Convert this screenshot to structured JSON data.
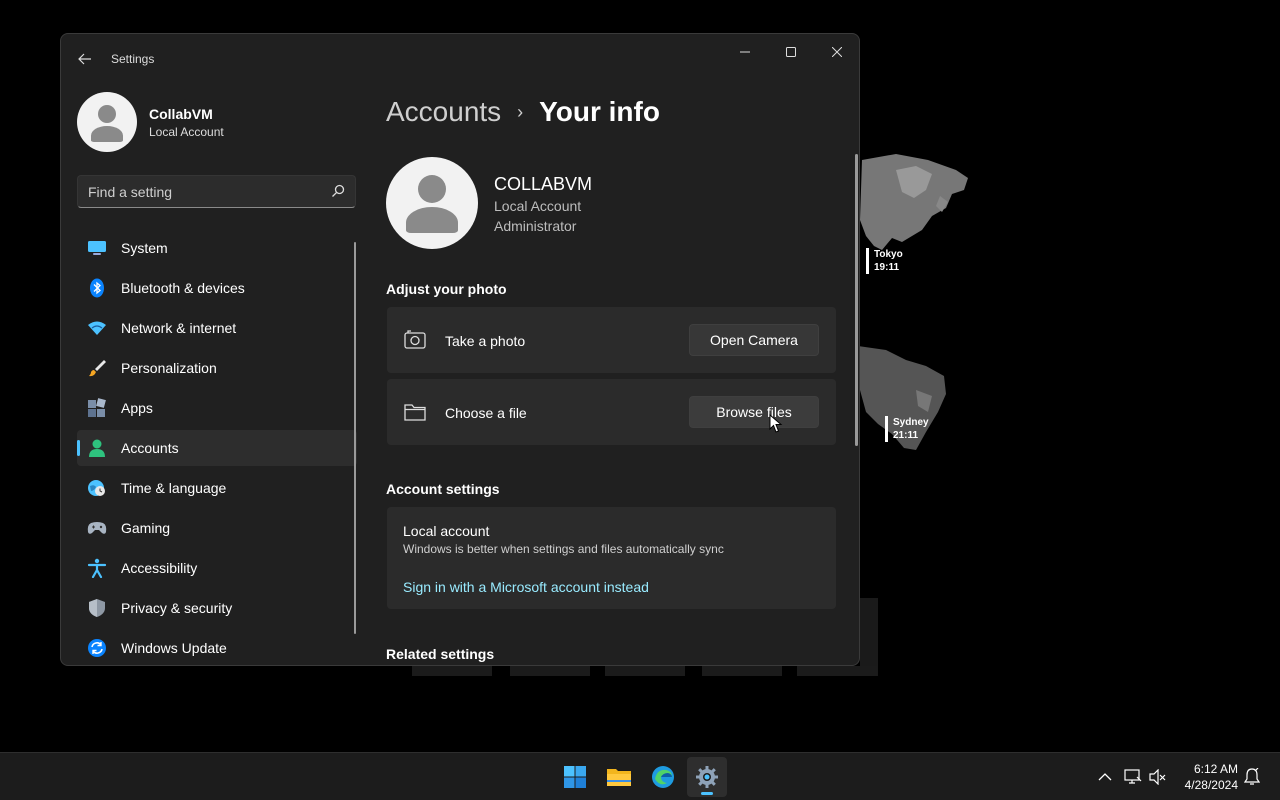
{
  "desktop": {
    "clocks": [
      {
        "city": "Tokyo",
        "time": "19:11"
      },
      {
        "city": "Sydney",
        "time": "21:11"
      }
    ]
  },
  "window": {
    "title": "Settings"
  },
  "profile": {
    "name": "CollabVM",
    "type": "Local Account"
  },
  "search": {
    "placeholder": "Find a setting"
  },
  "nav": {
    "items": [
      {
        "label": "System",
        "icon": "system-icon"
      },
      {
        "label": "Bluetooth & devices",
        "icon": "bluetooth-icon"
      },
      {
        "label": "Network & internet",
        "icon": "wifi-icon"
      },
      {
        "label": "Personalization",
        "icon": "brush-icon"
      },
      {
        "label": "Apps",
        "icon": "apps-icon"
      },
      {
        "label": "Accounts",
        "icon": "accounts-icon",
        "active": true
      },
      {
        "label": "Time & language",
        "icon": "globe-clock-icon"
      },
      {
        "label": "Gaming",
        "icon": "gamepad-icon"
      },
      {
        "label": "Accessibility",
        "icon": "accessibility-icon"
      },
      {
        "label": "Privacy & security",
        "icon": "shield-icon"
      },
      {
        "label": "Windows Update",
        "icon": "update-icon"
      }
    ]
  },
  "breadcrumb": {
    "parent": "Accounts",
    "separator": "›",
    "current": "Your info"
  },
  "user": {
    "name": "COLLABVM",
    "account_type": "Local Account",
    "role": "Administrator"
  },
  "photo": {
    "section_title": "Adjust your photo",
    "take_label": "Take a photo",
    "take_button": "Open Camera",
    "choose_label": "Choose a file",
    "choose_button": "Browse files"
  },
  "account_settings": {
    "section_title": "Account settings",
    "title": "Local account",
    "description": "Windows is better when settings and files automatically sync",
    "link": "Sign in with a Microsoft account instead"
  },
  "related": {
    "section_title": "Related settings"
  },
  "taskbar": {
    "time": "6:12 AM",
    "date": "4/28/2024"
  },
  "colors": {
    "accent": "#4cc2ff",
    "link": "#99ebff",
    "window_bg": "#202020",
    "card_bg": "#2b2b2b"
  }
}
